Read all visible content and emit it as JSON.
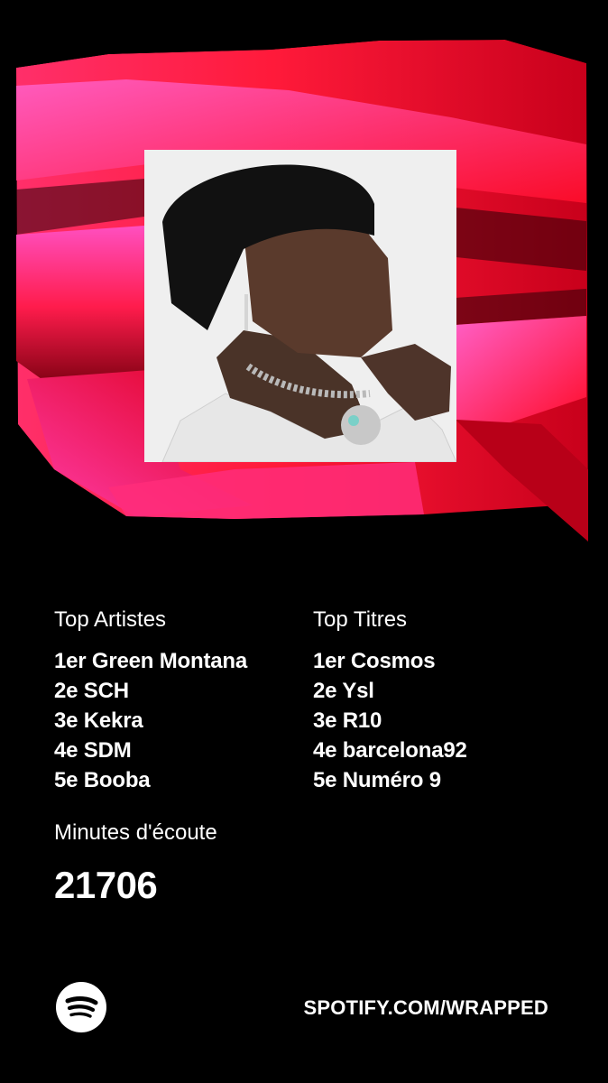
{
  "colors": {
    "background": "#000000",
    "accent_red": "#ff1d2e",
    "accent_pink": "#ff3bb8"
  },
  "cover": {
    "image": "artist-portrait"
  },
  "top_artists": {
    "heading": "Top Artistes",
    "items": [
      "1er Green Montana",
      "2e SCH",
      "3e Kekra",
      "4e SDM",
      "5e Booba"
    ]
  },
  "top_tracks": {
    "heading": "Top Titres",
    "items": [
      "1er Cosmos",
      "2e Ysl",
      "3e R10",
      "4e barcelona92",
      "5e Numéro 9"
    ]
  },
  "minutes": {
    "label": "Minutes d'écoute",
    "value": "21706"
  },
  "footer": {
    "logo_icon": "spotify-logo-icon",
    "url": "SPOTIFY.COM/WRAPPED"
  }
}
